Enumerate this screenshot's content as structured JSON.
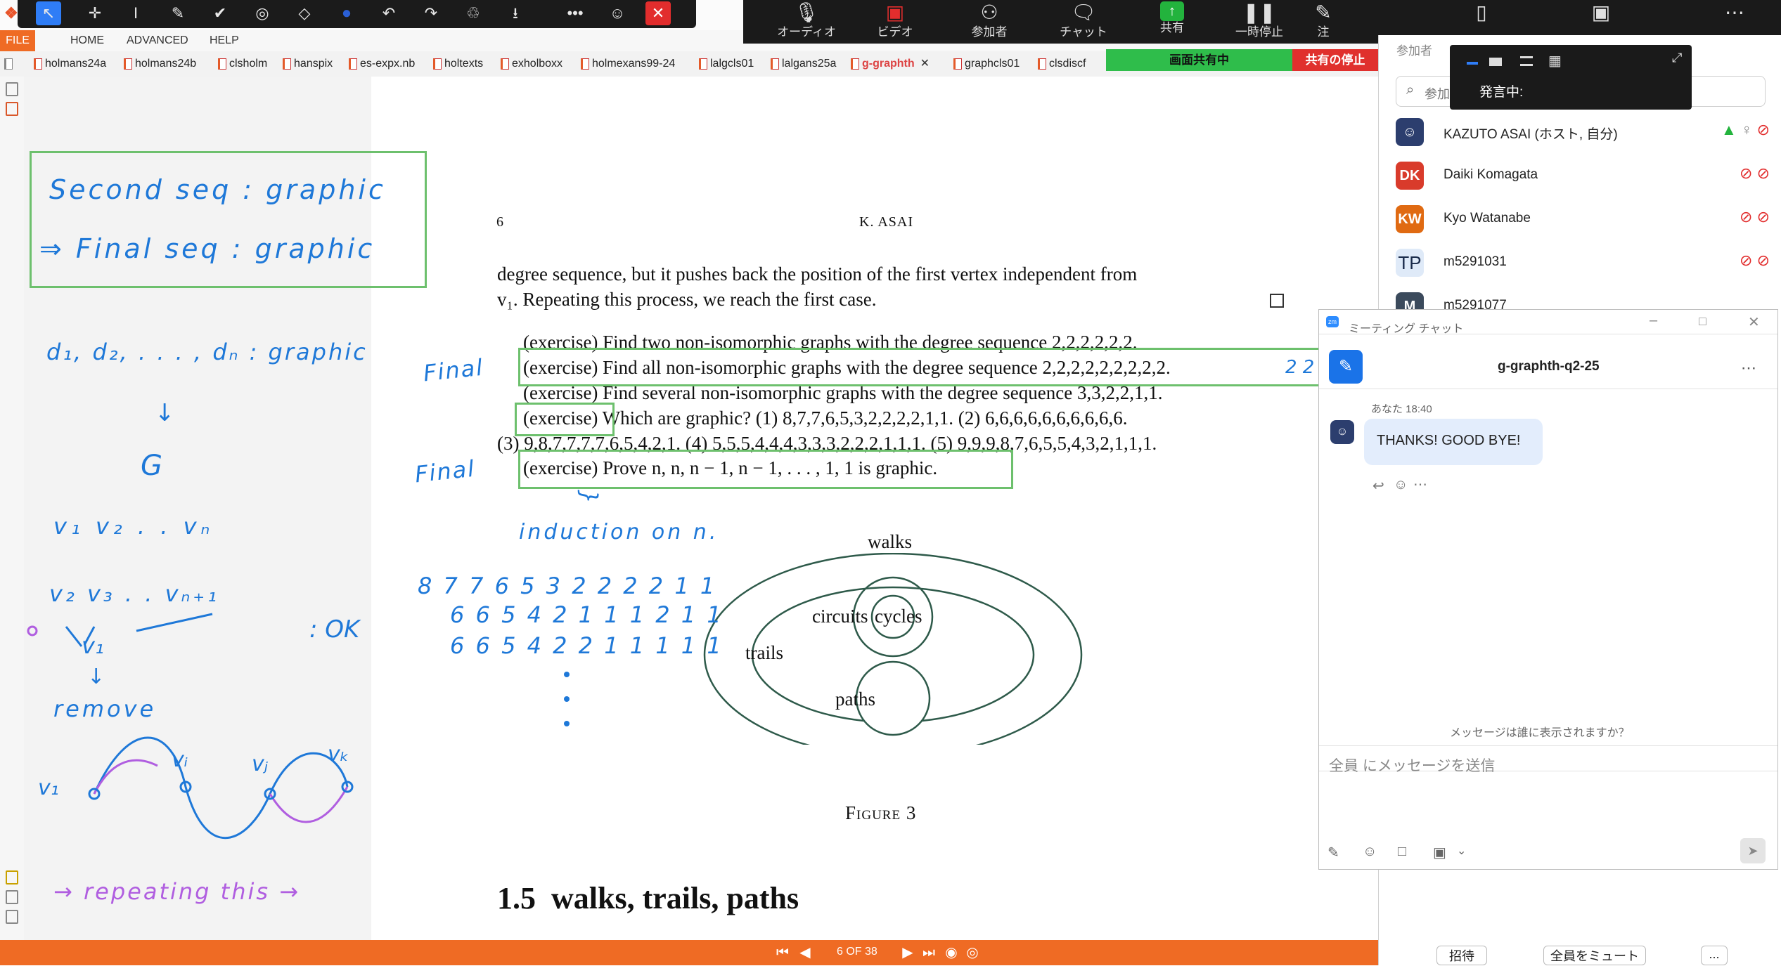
{
  "ribbon": {
    "file": "FILE",
    "home": "HOME",
    "advanced": "ADVANCED",
    "help": "HELP"
  },
  "doc_tabs": [
    {
      "label": "holmans24a"
    },
    {
      "label": "holmans24b"
    },
    {
      "label": "clsholm"
    },
    {
      "label": "hanspix"
    },
    {
      "label": "es-expx.nb"
    },
    {
      "label": "holtexts"
    },
    {
      "label": "exholboxx"
    },
    {
      "label": "holmexans99-24"
    },
    {
      "label": "lalgcls01"
    },
    {
      "label": "lalgans25a"
    },
    {
      "label": "g-graphth"
    },
    {
      "label": "graphcls01"
    },
    {
      "label": "clsdiscf"
    }
  ],
  "page": {
    "number": "6",
    "header": "K. ASAI",
    "lines": [
      "degree sequence, but it pushes back the position of the first vertex independent from",
      "v₁. Repeating this process, we reach the first case.",
      "(exercise) Find two non-isomorphic graphs with the degree sequence 2,2,2,2,2,2.",
      "(exercise) Find all non-isomorphic graphs with the degree sequence 2,2,2,2,2,2,2,2,2.",
      "(exercise) Find several non-isomorphic graphs with the degree sequence 3,3,2,2,1,1.",
      "(exercise) Which are graphic? (1) 8,7,7,6,5,3,2,2,2,2,1,1.  (2) 6,6,6,6,6,6,6,6,6,6.",
      "(3) 9,8,7,7,7,7,6,5,4,2,1.  (4) 5,5,5,4,4,4,3,3,3,2,2,2,1,1,1.  (5) 9,9,9,8,7,6,5,5,4,3,2,1,1,1.",
      "(exercise) Prove n, n, n − 1, n − 1, . . . , 1, 1 is graphic."
    ],
    "figure_labels": {
      "walks": "walks",
      "trails": "trails",
      "circuits": "circuits",
      "cycles": "cycles",
      "paths": "paths"
    },
    "figure_caption": "Figure 3",
    "section_number": "1.5",
    "section_title": "walks, trails, paths"
  },
  "handwriting": {
    "box_line1": "Second seq : graphic",
    "box_line2": "⇒  Final seq : graphic",
    "d_seq": "d₁, d₂, . . . , dₙ : graphic",
    "down_arrow": "↓",
    "g": "G",
    "v_row": "v₁ v₂  . .  vₙ",
    "v_row2": "v₂ v₃ . . vₙ₊₁",
    "v1": "v₁",
    "ok": ": OK",
    "remove": "remove",
    "vi": "vᵢ",
    "vj": "vⱼ",
    "vk": "vₖ",
    "v1b": "v₁",
    "repeating": "→ repeating this →",
    "final1": "Final",
    "final2": "Final",
    "induction": "induction on n.",
    "brace": "}",
    "nums1": "8 7 7 6 5 3 2 2 2 2 1 1",
    "nums2": "6 6 5 4 2 1 1 1 2 1 1",
    "nums3": "6 6 5 4 2 2  1 1 1 1 1",
    "extra": "2 2"
  },
  "bottom_nav": {
    "page_indicator": "6 OF 38"
  },
  "annot_toolbar": {
    "icons": [
      "select-icon",
      "move-icon",
      "text-cursor-icon",
      "pen-icon",
      "check-icon",
      "stamp-icon",
      "eraser-icon",
      "color-icon",
      "undo-icon",
      "redo-icon",
      "trash-icon",
      "save-icon",
      "more-icon",
      "people-icon",
      "close-icon"
    ]
  },
  "zoom_bar": {
    "audio": "オーディオ",
    "video": "ビデオ",
    "participants": "参加者",
    "chat": "チャット",
    "share": "共有",
    "pause": "一時停止",
    "annotate": "注",
    "sharing_status": "画面共有中",
    "stop_share": "共有の停止"
  },
  "participants_panel": {
    "title": "参加者",
    "search_placeholder": "参加",
    "speaking": "発言中:",
    "participants": [
      {
        "initials": "",
        "name": "KAZUTO ASAI (ホスト, 自分)",
        "color": "#2c3e6e"
      },
      {
        "initials": "DK",
        "name": "Daiki Komagata",
        "color": "#d93b2b"
      },
      {
        "initials": "KW",
        "name": "Kyo Watanabe",
        "color": "#e06a12"
      },
      {
        "initials": "TP",
        "name": "m5291031",
        "color": "#dfeaf8"
      },
      {
        "initials": "M",
        "name": "m5291077",
        "color": "#3b4a5c"
      }
    ],
    "invite": "招待",
    "mute_all": "全員をミュート",
    "more": "..."
  },
  "chat": {
    "window_title": "ミーティング チャット",
    "header": "g-graphth-q2-25",
    "sender": "あなた 18:40",
    "message": "THANKS! GOOD BYE!",
    "who_sees": "メッセージは誰に表示されますか？",
    "input_placeholder": "全員 にメッセージを送信"
  },
  "colors": {
    "accent_orange": "#ef6b24",
    "annotation_green": "#6dc06d",
    "ink_blue": "#1e78d8",
    "ink_purple": "#b05ee0",
    "zoom_green": "#2fbd4b",
    "stop_red": "#e0302d"
  }
}
